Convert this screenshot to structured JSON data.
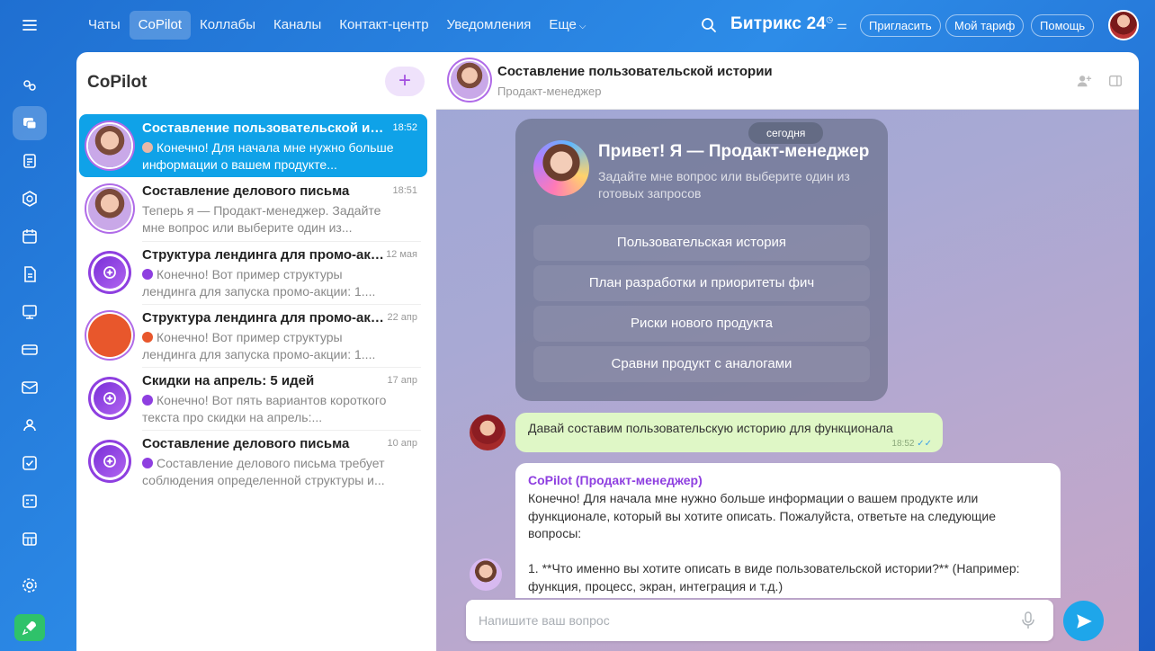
{
  "topbar": {
    "nav": [
      "Чаты",
      "CoPilot",
      "Коллабы",
      "Каналы",
      "Контакт-центр",
      "Уведомления",
      "Еще"
    ],
    "brand_name": "Битрикс",
    "brand_num": "24",
    "invite": "Пригласить",
    "tariff": "Мой тариф",
    "help": "Помощь"
  },
  "sidebar_icons": [
    "menu-icon",
    "feed-icon",
    "chat-icon",
    "tasks-icon",
    "crm-icon",
    "calendar-icon",
    "documents-icon",
    "board-icon",
    "shop-icon",
    "mail-icon",
    "contacts-icon",
    "checklist-icon",
    "planner-icon",
    "store-icon",
    "settings-icon",
    "rocket-icon"
  ],
  "list": {
    "title": "CoPilot",
    "add_label": "+",
    "chats": [
      {
        "title": "Составление пользовательской исто...",
        "time": "18:52",
        "preview": "Конечно! Для начала мне нужно больше информации о вашем продукте..."
      },
      {
        "title": "Составление делового письма",
        "time": "18:51",
        "preview": "Теперь я — Продакт-менеджер. Задайте мне вопрос или выберите один из..."
      },
      {
        "title": "Структура лендинга для промо-акц...",
        "time": "12 мая",
        "preview": "Конечно! Вот пример структуры лендинга для запуска промо-акции: 1...."
      },
      {
        "title": "Структура лендинга для промо-акц...",
        "time": "22 апр",
        "preview": "Конечно! Вот пример структуры лендинга для запуска промо-акции: 1...."
      },
      {
        "title": "Скидки на апрель: 5 идей",
        "time": "17 апр",
        "preview": "Конечно! Вот пять вариантов короткого текста про скидки на апрель:..."
      },
      {
        "title": "Составление делового письма",
        "time": "10 апр",
        "preview": "Составление делового письма требует соблюдения определенной структуры и..."
      }
    ]
  },
  "chat": {
    "title": "Составление пользовательской истории",
    "subtitle": "Продакт-менеджер",
    "date": "сегодня",
    "welcome_title": "Привет! Я — Продакт-менеджер",
    "welcome_sub": "Задайте мне вопрос или выберите один из готовых запросов",
    "prompts": [
      "Пользовательская история",
      "План разработки и приоритеты фич",
      "Риски нового продукта",
      "Сравни продукт с аналогами"
    ],
    "user_msg": "Давай составим пользовательскую историю для функционала",
    "user_time": "18:52",
    "bot_name": "CoPilot (Продакт-менеджер)",
    "bot_text": "Конечно! Для начала мне нужно больше информации о вашем продукте или функционале, который вы хотите описать. Пожалуйста, ответьте на следующие вопросы:\n\n1. **Что именно вы хотите описать в виде пользовательской истории?** (Например: функция, процесс, экран, интеграция и т.д.)",
    "input_placeholder": "Напишите ваш вопрос"
  },
  "colors": {
    "accent": "#0fa2e8",
    "copilot": "#8e3fe0",
    "user_bubble": "#dff7c6",
    "send": "#1ea6ea"
  }
}
